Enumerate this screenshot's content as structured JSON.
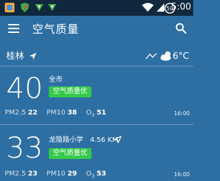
{
  "status_bar": {
    "time": "5:00",
    "icons": [
      "app-notification-icon",
      "shield-app-icon",
      "green-app-icon",
      "green-app-icon",
      "wifi-icon",
      "cellular-signal-icon",
      "battery-icon"
    ]
  },
  "app_bar": {
    "title": "空气质量",
    "menu_icon": "hamburger-menu-icon",
    "search_icon": "search-icon"
  },
  "city": {
    "name": "桂林",
    "location_icon": "location-arrow-icon",
    "trend_icon": "trend-icon",
    "weather_icon": "partly-cloudy-icon",
    "temperature": "6°C"
  },
  "stations": [
    {
      "aqi": "40",
      "name": "全市",
      "badge": "空气质量优",
      "pm25_label": "PM2.5",
      "pm25": "22",
      "pm10_label": "PM10",
      "pm10": "38",
      "o3_label": "O",
      "o3_sub": "3",
      "o3": "51",
      "time": "16:00"
    },
    {
      "aqi": "33",
      "name": "龙隐路小学",
      "distance": "4.56 KM",
      "badge": "空气质量优",
      "pm25_label": "PM2.5",
      "pm25": "23",
      "pm10_label": "PM10",
      "pm10": "29",
      "o3_label": "O",
      "o3_sub": "3",
      "o3": "53",
      "time": "16:00"
    }
  ],
  "colors": {
    "background": "#2e6fa3",
    "status_bar": "#10283d",
    "badge": "#35c94b"
  }
}
